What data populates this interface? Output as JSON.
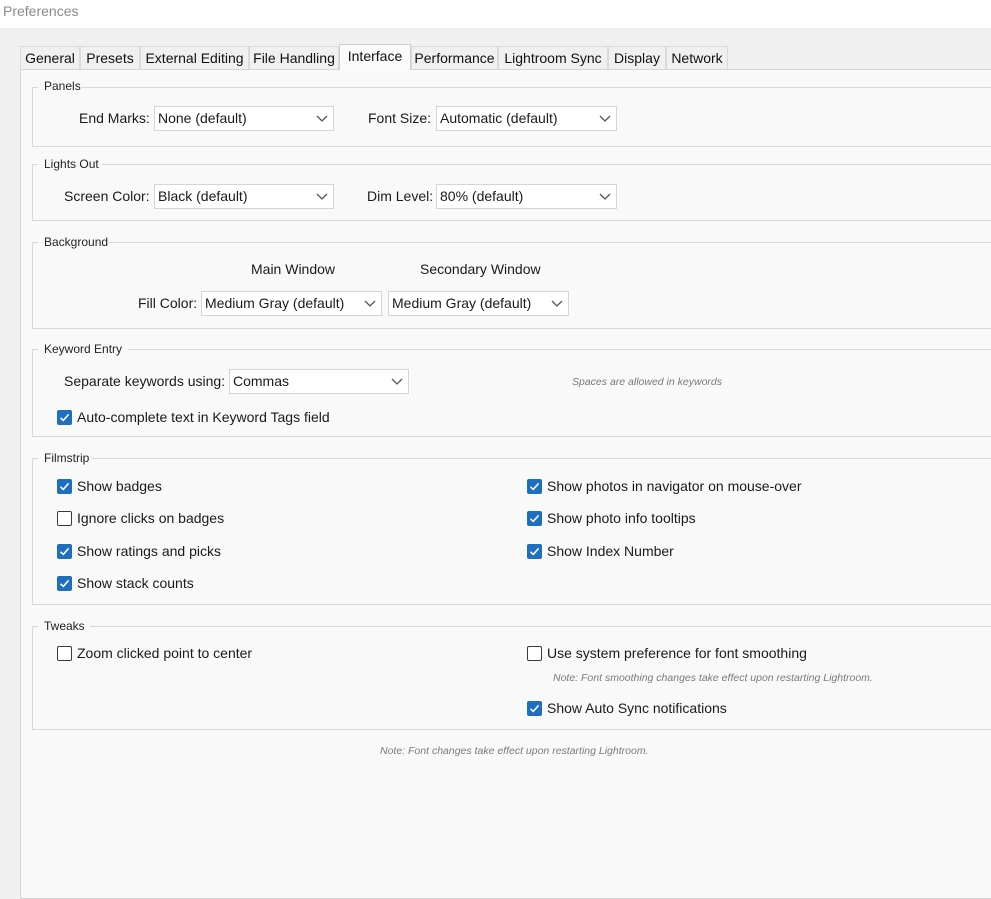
{
  "window": {
    "title": "Preferences"
  },
  "tabs": [
    {
      "label": "General"
    },
    {
      "label": "Presets"
    },
    {
      "label": "External Editing"
    },
    {
      "label": "File Handling"
    },
    {
      "label": "Interface"
    },
    {
      "label": "Performance"
    },
    {
      "label": "Lightroom Sync"
    },
    {
      "label": "Display"
    },
    {
      "label": "Network"
    }
  ],
  "active_tab": "Interface",
  "panels": {
    "title": "Panels",
    "end_marks_label": "End Marks:",
    "end_marks_value": "None (default)",
    "font_size_label": "Font Size:",
    "font_size_value": "Automatic (default)"
  },
  "lights_out": {
    "title": "Lights Out",
    "screen_color_label": "Screen Color:",
    "screen_color_value": "Black (default)",
    "dim_level_label": "Dim Level:",
    "dim_level_value": "80% (default)"
  },
  "background": {
    "title": "Background",
    "main_window_label": "Main Window",
    "secondary_window_label": "Secondary Window",
    "fill_color_label": "Fill Color:",
    "main_fill_value": "Medium Gray (default)",
    "secondary_fill_value": "Medium Gray (default)"
  },
  "keyword_entry": {
    "title": "Keyword Entry",
    "separate_label": "Separate keywords using:",
    "separate_value": "Commas",
    "spaces_note": "Spaces are allowed in keywords",
    "autocomplete_label": "Auto-complete text in Keyword Tags field",
    "autocomplete_checked": true
  },
  "filmstrip": {
    "title": "Filmstrip",
    "show_badges": {
      "label": "Show badges",
      "checked": true
    },
    "ignore_clicks": {
      "label": "Ignore clicks on badges",
      "checked": false
    },
    "show_ratings": {
      "label": "Show ratings and picks",
      "checked": true
    },
    "show_stack_counts": {
      "label": "Show stack counts",
      "checked": true
    },
    "show_photos_navigator": {
      "label": "Show photos in navigator on mouse-over",
      "checked": true
    },
    "show_photo_info": {
      "label": "Show photo info tooltips",
      "checked": true
    },
    "show_index_number": {
      "label": "Show Index Number",
      "checked": true
    }
  },
  "tweaks": {
    "title": "Tweaks",
    "zoom_clicked": {
      "label": "Zoom clicked point to center",
      "checked": false
    },
    "system_font_smoothing": {
      "label": "Use system preference for font smoothing",
      "checked": false
    },
    "font_smoothing_note": "Note: Font smoothing changes take effect upon restarting Lightroom.",
    "auto_sync_notifications": {
      "label": "Show Auto Sync notifications",
      "checked": true
    }
  },
  "footer_note": "Note: Font changes take effect upon restarting Lightroom.",
  "colors": {
    "checkbox_accent": "#1f6fbf",
    "window_background": "#f0f0f0",
    "content_background": "#f9f9f9"
  }
}
